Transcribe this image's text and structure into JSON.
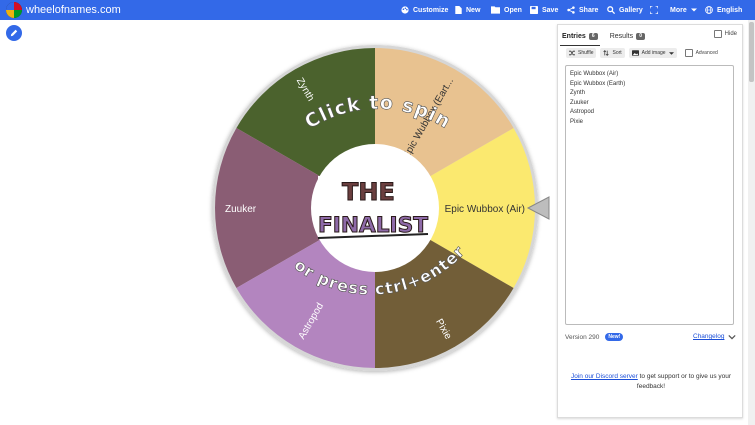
{
  "header": {
    "site_name": "wheelofnames.com",
    "nav": {
      "customize": "Customize",
      "new": "New",
      "open": "Open",
      "save": "Save",
      "share": "Share",
      "gallery": "Gallery",
      "more": "More",
      "language": "English"
    }
  },
  "wheel": {
    "center_logo_line1": "THE",
    "center_logo_line2": "FINALIST",
    "prompt_top": "Click to spin",
    "prompt_bottom": "or press ctrl+enter",
    "segments": [
      {
        "label": "Epic Wubbox (Air)",
        "color": "#fbe96f"
      },
      {
        "label": "Epic Wubbox (Eart...",
        "color": "#e8c290"
      },
      {
        "label": "Zynth",
        "color": "#4b622d"
      },
      {
        "label": "Zuuker",
        "color": "#8a5d74"
      },
      {
        "label": "Astropod",
        "color": "#b385bf"
      },
      {
        "label": "Pixie",
        "color": "#725e38"
      }
    ]
  },
  "panel": {
    "tabs": {
      "entries_label": "Entries",
      "entries_count": "6",
      "results_label": "Results",
      "results_count": "0"
    },
    "hide_label": "Hide",
    "toolbar": {
      "shuffle": "Shuffle",
      "sort": "Sort",
      "add_image": "Add image",
      "advanced": "Advanced"
    },
    "entries": [
      "Epic Wubbox (Air)",
      "Epic Wubbox (Earth)",
      "Zynth",
      "Zuuker",
      "Astropod",
      "Pixie"
    ],
    "version_text": "Version 290",
    "new_badge": "New!",
    "changelog": "Changelog",
    "discord_link": "Join our Discord server",
    "discord_rest": " to get support or to give us your feedback!"
  }
}
